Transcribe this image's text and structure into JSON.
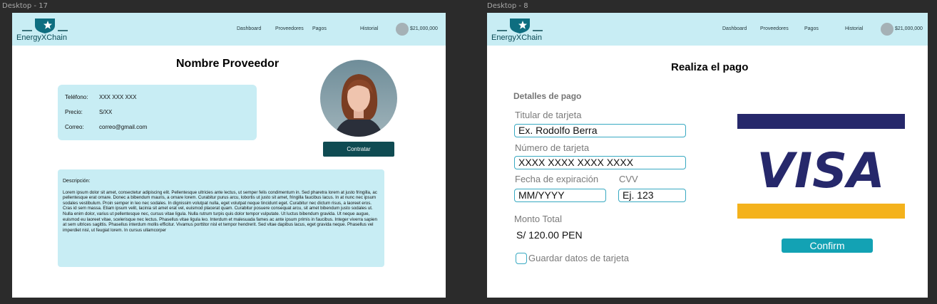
{
  "colors": {
    "header_bg": "#c8edf4",
    "accent_dark": "#0f4b52",
    "accent": "#13a2b4",
    "visa_blue": "#26286b",
    "visa_gold": "#f4b21c"
  },
  "frame1": {
    "label": "Desktop - 17",
    "header": {
      "logo_text": "EnergyXChain",
      "nav": [
        "Dashboard",
        "Proveedores",
        "Pagos",
        "Historial"
      ],
      "balance": "$21,000,000"
    },
    "title": "Nombre Proveedor",
    "info": [
      {
        "label": "Teléfono:",
        "value": "XXX XXX XXX"
      },
      {
        "label": "Precio:",
        "value": "S/XX"
      },
      {
        "label": "Correo:",
        "value": "correo@gmail.com"
      }
    ],
    "contratar_label": "Contratar",
    "description_label": "Descripción:",
    "description_text": "Lorem ipsum dolor sit amet, consectetur adipiscing elit. Pellentesque ultricies ante lectus, ut semper felis condimentum in. Sed pharetra lorem at justo fringilla, ac pellentesque erat ornare. Donec a bibendum mauris, a ornare lorem. Curabitur purus arcu, lobortis ut justo sit amet, fringilla faucibus lacus. In at nunc nec ipsum sodales vestibulum. Proin semper in leo nec sodales. In dignissim volutpat nulla, eget volutpat neque tincidunt eget. Curabitur nec dictum risus, a laoreet eros. Cras id sem massa. Etiam ipsum velit, lacinia sit amet erat vel, euismod placerat quam. Curabitur posuere consequat arcu, sit amet bibendum justo sodales ut. Nulla enim dolor, varius ut pellentesque nec, cursus vitae ligula. Nulla rutrum turpis quis dolor tempor vulputate. Ut luctus bibendum gravida. Ut neque augue, euismod eu laoreet vitae, scelerisque nec lectus. Phasellus vitae ligula leo. Interdum et malesuada fames ac ante ipsum primis in faucibus. Integer viverra sapien at sem ultrices sagittis. Phasellus interdum mollis efficitur. Vivamus porttitor nisl et tempor hendrerit. Sed vitae dapibus lacus, eget gravida neque. Phasellus vel imperdiet nisl, ut feugiat lorem. In cursus ullamcorper"
  },
  "frame2": {
    "label": "Desktop - 8",
    "header": {
      "logo_text": "EnergyXChain",
      "nav": [
        "Dashboard",
        "Proveedores",
        "Pagos",
        "Historial"
      ],
      "balance": "$21,000,000"
    },
    "title": "Realiza el pago",
    "section_title": "Detalles de pago",
    "holder_label": "Titular de tarjeta",
    "holder_placeholder": "Ex. Rodolfo Berra",
    "number_label": "Número de tarjeta",
    "number_placeholder": "XXXX XXXX XXXX XXXX",
    "expiry_label": "Fecha de expiración",
    "expiry_placeholder": "MM/YYYY",
    "cvv_label": "CVV",
    "cvv_placeholder": "Ej. 123",
    "total_label": "Monto Total",
    "total_value": "S/ 120.00 PEN",
    "save_card_label": "Guardar datos de tarjeta",
    "card_brand": "VISA",
    "confirm_label": "Confirm"
  }
}
